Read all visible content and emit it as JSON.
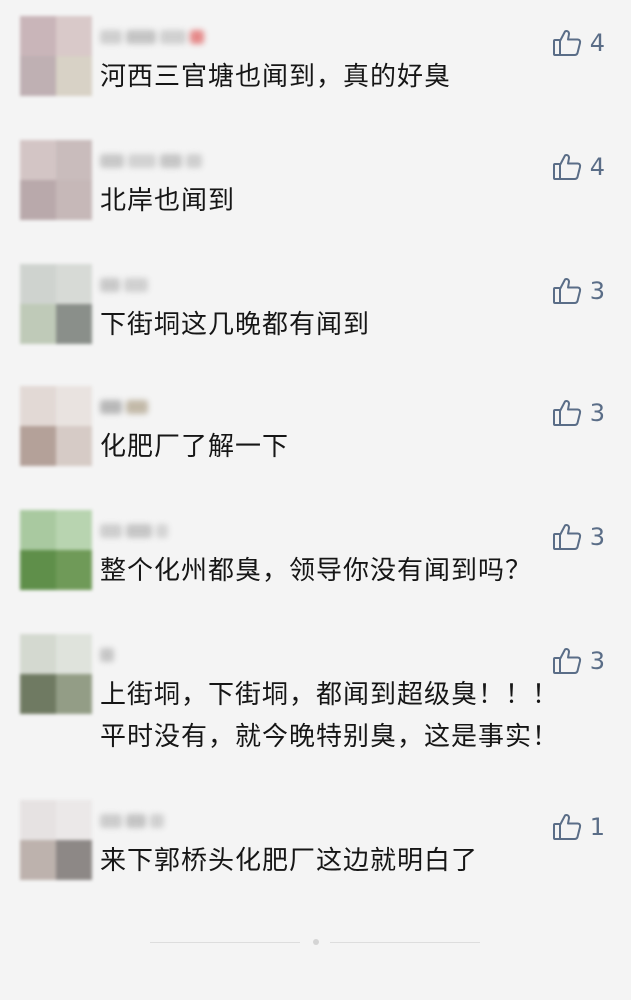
{
  "colors": {
    "background": "#f4f4f4",
    "like_icon": "#5a6d87",
    "text": "#161616"
  },
  "comments": [
    {
      "likes": "4",
      "lines": [
        "河西三官塘也闻到，真的好臭"
      ]
    },
    {
      "likes": "4",
      "lines": [
        "北岸也闻到"
      ]
    },
    {
      "likes": "3",
      "lines": [
        "下街垌这几晚都有闻到"
      ]
    },
    {
      "likes": "3",
      "lines": [
        "化肥厂了解一下"
      ]
    },
    {
      "likes": "3",
      "lines": [
        "整个化州都臭，领导你没有闻到吗？"
      ]
    },
    {
      "likes": "3",
      "lines": [
        "上街垌，下街垌，都闻到超级臭！！！",
        "平时没有，就今晚特别臭，这是事实！"
      ]
    },
    {
      "likes": "1",
      "lines": [
        "来下郭桥头化肥厂这边就明白了"
      ]
    }
  ],
  "like_icon": "thumbs-up-icon"
}
